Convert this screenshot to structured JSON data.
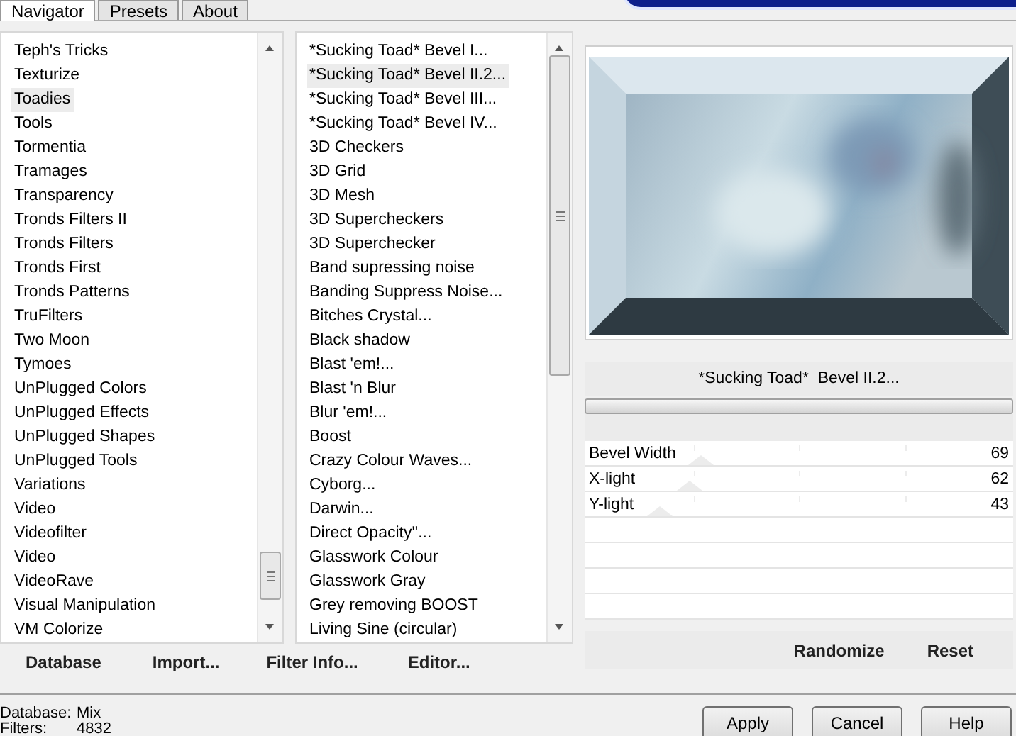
{
  "tabs": [
    {
      "label": "Navigator",
      "selected": true
    },
    {
      "label": "Presets",
      "selected": false
    },
    {
      "label": "About",
      "selected": false
    }
  ],
  "categories": [
    {
      "label": "Teph's Tricks",
      "selected": false
    },
    {
      "label": "Texturize",
      "selected": false
    },
    {
      "label": "Toadies",
      "selected": true
    },
    {
      "label": "Tools",
      "selected": false
    },
    {
      "label": "Tormentia",
      "selected": false
    },
    {
      "label": "Tramages",
      "selected": false
    },
    {
      "label": "Transparency",
      "selected": false
    },
    {
      "label": "Tronds Filters II",
      "selected": false
    },
    {
      "label": "Tronds Filters",
      "selected": false
    },
    {
      "label": "Tronds First",
      "selected": false
    },
    {
      "label": "Tronds Patterns",
      "selected": false
    },
    {
      "label": "TruFilters",
      "selected": false
    },
    {
      "label": "Two Moon",
      "selected": false
    },
    {
      "label": "Tymoes",
      "selected": false
    },
    {
      "label": "UnPlugged Colors",
      "selected": false
    },
    {
      "label": "UnPlugged Effects",
      "selected": false
    },
    {
      "label": "UnPlugged Shapes",
      "selected": false
    },
    {
      "label": "UnPlugged Tools",
      "selected": false
    },
    {
      "label": "Variations",
      "selected": false
    },
    {
      "label": "Video",
      "selected": false
    },
    {
      "label": "Videofilter",
      "selected": false
    },
    {
      "label": "Video",
      "selected": false
    },
    {
      "label": "VideoRave",
      "selected": false
    },
    {
      "label": "Visual Manipulation",
      "selected": false
    },
    {
      "label": "VM Colorize",
      "selected": false
    }
  ],
  "filters": [
    {
      "label": "*Sucking Toad*  Bevel I...",
      "selected": false
    },
    {
      "label": "*Sucking Toad*  Bevel II.2...",
      "selected": true
    },
    {
      "label": "*Sucking Toad*  Bevel III...",
      "selected": false
    },
    {
      "label": "*Sucking Toad*  Bevel IV...",
      "selected": false
    },
    {
      "label": "3D Checkers",
      "selected": false
    },
    {
      "label": "3D Grid",
      "selected": false
    },
    {
      "label": "3D Mesh",
      "selected": false
    },
    {
      "label": "3D Supercheckers",
      "selected": false
    },
    {
      "label": "3D Superchecker",
      "selected": false
    },
    {
      "label": "Band supressing noise",
      "selected": false
    },
    {
      "label": "Banding Suppress Noise...",
      "selected": false
    },
    {
      "label": "Bitches Crystal...",
      "selected": false
    },
    {
      "label": "Black shadow",
      "selected": false
    },
    {
      "label": "Blast 'em!...",
      "selected": false
    },
    {
      "label": "Blast 'n Blur",
      "selected": false
    },
    {
      "label": "Blur 'em!...",
      "selected": false
    },
    {
      "label": "Boost",
      "selected": false
    },
    {
      "label": "Crazy Colour Waves...",
      "selected": false
    },
    {
      "label": "Cyborg...",
      "selected": false
    },
    {
      "label": "Darwin...",
      "selected": false
    },
    {
      "label": "Direct Opacity''...",
      "selected": false
    },
    {
      "label": "Glasswork Colour",
      "selected": false
    },
    {
      "label": "Glasswork Gray",
      "selected": false
    },
    {
      "label": "Grey removing BOOST",
      "selected": false
    },
    {
      "label": "Living Sine (circular)",
      "selected": false
    }
  ],
  "list_buttons": [
    "Database",
    "Import...",
    "Filter Info...",
    "Editor..."
  ],
  "preview": {
    "filter_name": "*Sucking Toad*  Bevel II.2...",
    "level": 1
  },
  "parameters": [
    {
      "name": "Bevel Width",
      "value": "69",
      "level": 0.27
    },
    {
      "name": "X-light",
      "value": "62",
      "level": 0.24
    },
    {
      "name": "Y-light",
      "value": "43",
      "level": 0.17
    }
  ],
  "parameter_buttons": [
    "Randomize",
    "Reset"
  ],
  "status": [
    {
      "label": "Database:",
      "value": "Mix"
    },
    {
      "label": "Filters:",
      "value": "4832"
    }
  ],
  "dialog_buttons": [
    "Apply",
    "Cancel",
    "Help"
  ]
}
